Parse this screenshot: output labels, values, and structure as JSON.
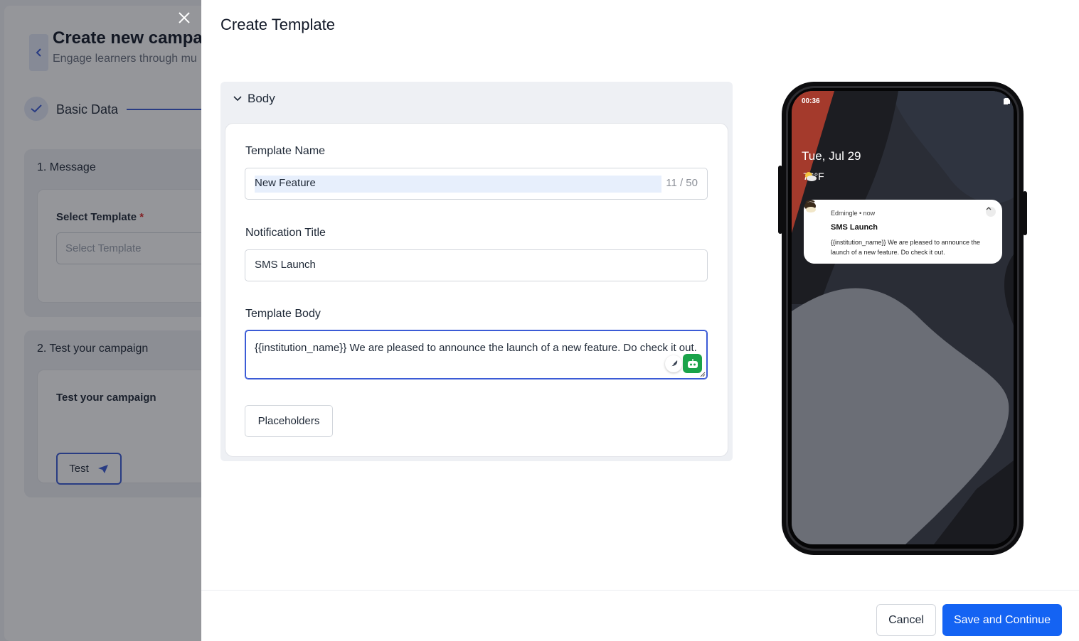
{
  "background": {
    "title": "Create new campa",
    "subtitle": "Engage learners through mu",
    "step": {
      "label": "Basic Data"
    },
    "section1": {
      "title": "1. Message",
      "field_label": "Select Template",
      "required_mark": "*",
      "placeholder": "Select Template"
    },
    "section2": {
      "title": "2. Test your campaign",
      "inner_title": "Test your campaign",
      "test_button": "Test"
    }
  },
  "drawer": {
    "title": "Create Template",
    "panel_header": "Body",
    "template_name": {
      "label": "Template Name",
      "value": "New Feature",
      "counter": "11 / 50"
    },
    "notification_title": {
      "label": "Notification Title",
      "value": "SMS Launch"
    },
    "template_body": {
      "label": "Template Body",
      "value": "{{institution_name}} We are pleased to announce the launch of a new feature. Do check it out."
    },
    "placeholders_button": "Placeholders",
    "footer": {
      "cancel": "Cancel",
      "save": "Save and Continue"
    }
  },
  "phone_preview": {
    "time": "00:36",
    "date": "Tue, Jul 29",
    "temperature": "76°F",
    "notification": {
      "app": "Edmingle • now",
      "title": "SMS Launch",
      "body": "{{institution_name}} We are pleased to announce the launch of a new feature. Do check it out."
    }
  },
  "icons": [
    "close-icon",
    "chevron-left-icon",
    "check-icon",
    "send-icon",
    "chevron-down-icon",
    "feather-icon",
    "bot-icon",
    "wifi-icon",
    "signal-icon",
    "battery-icon",
    "weather-icon",
    "chevron-up-icon"
  ],
  "colors": {
    "primary": "#1463f3",
    "accent": "#3b5bd6",
    "success": "#1aa34a",
    "required": "#dc2626"
  }
}
